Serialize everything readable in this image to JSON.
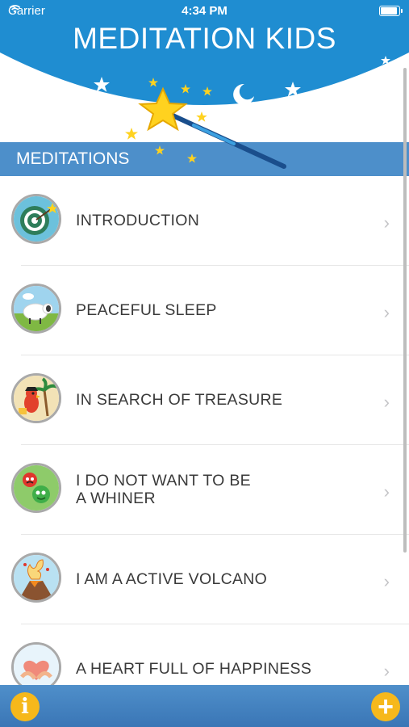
{
  "status_bar": {
    "carrier": "Carrier",
    "time": "4:34 PM",
    "battery_level": 0.85
  },
  "header": {
    "title": "MEDITATION KIDS"
  },
  "section": {
    "title": "MEDITATIONS"
  },
  "meditations": [
    {
      "label": "INTRODUCTION",
      "icon": "target-icon"
    },
    {
      "label": "PEACEFUL SLEEP",
      "icon": "sheep-icon"
    },
    {
      "label": "IN SEARCH OF TREASURE",
      "icon": "parrot-treasure-icon"
    },
    {
      "label": "I DO NOT WANT TO BE\nA WHINER",
      "icon": "monsters-icon"
    },
    {
      "label": "I AM A ACTIVE VOLCANO",
      "icon": "volcano-icon"
    },
    {
      "label": "A HEART FULL OF HAPPINESS",
      "icon": "heart-hands-icon"
    }
  ],
  "tab_bar": {
    "info_glyph": "i",
    "add_glyph": "+"
  },
  "colors": {
    "header_blue": "#1f8dd1",
    "section_blue": "#4d8fca",
    "accent_yellow": "#f6b81b"
  }
}
